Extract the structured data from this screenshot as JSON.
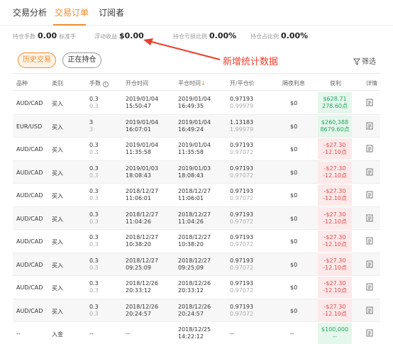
{
  "tabs": [
    {
      "label": "交易分析"
    },
    {
      "label": "交易订单"
    },
    {
      "label": "订阅者"
    }
  ],
  "stats": {
    "lots_label": "持仓手数",
    "lots_value": "0.00",
    "lots_sub": "标准手",
    "float_label": "浮动收益",
    "float_value": "$0.00",
    "loss_ratio_label": "持仓亏损比例",
    "loss_ratio_value": "0.00%",
    "ratio_label": "持仓占比例",
    "ratio_value": "0.00%"
  },
  "annotation": {
    "text": "新增统计数据",
    "color": "#e8402e"
  },
  "buttons": {
    "history": "历史交易",
    "open": "正在持仓",
    "filter": "筛选"
  },
  "columns": [
    "品种",
    "类别",
    "手数",
    "开仓时间",
    "平仓时间",
    "开/平仓价",
    "隔夜利息",
    "获利",
    "详情"
  ],
  "rows": [
    {
      "symbol": "AUD/CAD",
      "type": "买入",
      "lots": "0.3",
      "lots2": "0.3",
      "open_date": "2019/01/04",
      "open_time": "15:50:47",
      "close_date": "2019/01/04",
      "close_time": "16:49:35",
      "price1": "0.97193",
      "price2": "0.99979",
      "swap": "$0",
      "profit": "$628.71",
      "points": "278.60点",
      "positive": true
    },
    {
      "symbol": "EUR/USD",
      "type": "买入",
      "lots": "3",
      "lots2": "3",
      "open_date": "2019/01/04",
      "open_time": "16:07:01",
      "close_date": "2019/01/04",
      "close_time": "16:49:24",
      "price1": "1.13183",
      "price2": "1.99979",
      "swap": "$0",
      "profit": "$260,388",
      "points": "8679.60点",
      "positive": true
    },
    {
      "symbol": "AUD/CAD",
      "type": "买入",
      "lots": "0.3",
      "lots2": "0.3",
      "open_date": "2019/01/04",
      "open_time": "11:35:58",
      "close_date": "2019/01/04",
      "close_time": "11:35:58",
      "price1": "0.97193",
      "price2": "0.97072",
      "swap": "$0",
      "profit": "-$27.30",
      "points": "-12.10点",
      "positive": false
    },
    {
      "symbol": "AUD/CAD",
      "type": "买入",
      "lots": "0.3",
      "lots2": "0.3",
      "open_date": "2019/01/03",
      "open_time": "18:08:43",
      "close_date": "2019/01/03",
      "close_time": "18:08:43",
      "price1": "0.97193",
      "price2": "0.97072",
      "swap": "$0",
      "profit": "-$27.30",
      "points": "-12.10点",
      "positive": false
    },
    {
      "symbol": "AUD/CAD",
      "type": "买入",
      "lots": "0.3",
      "lots2": "0.3",
      "open_date": "2018/12/27",
      "open_time": "11:06:01",
      "close_date": "2018/12/27",
      "close_time": "11:06:01",
      "price1": "0.97193",
      "price2": "0.97072",
      "swap": "$0",
      "profit": "-$27.30",
      "points": "-12.10点",
      "positive": false
    },
    {
      "symbol": "AUD/CAD",
      "type": "买入",
      "lots": "0.3",
      "lots2": "0.3",
      "open_date": "2018/12/27",
      "open_time": "11:04:26",
      "close_date": "2018/12/27",
      "close_time": "11:04:26",
      "price1": "0.97193",
      "price2": "0.97072",
      "swap": "$0",
      "profit": "-$27.30",
      "points": "-12.10点",
      "positive": false
    },
    {
      "symbol": "AUD/CAD",
      "type": "买入",
      "lots": "0.3",
      "lots2": "0.3",
      "open_date": "2018/12/27",
      "open_time": "10:38:20",
      "close_date": "2018/12/27",
      "close_time": "10:38:20",
      "price1": "0.97193",
      "price2": "0.97072",
      "swap": "$0",
      "profit": "-$27.30",
      "points": "-12.10点",
      "positive": false
    },
    {
      "symbol": "AUD/CAD",
      "type": "买入",
      "lots": "0.3",
      "lots2": "0.3",
      "open_date": "2018/12/27",
      "open_time": "09:25:09",
      "close_date": "2018/12/27",
      "close_time": "09:25:09",
      "price1": "0.97193",
      "price2": "0.97072",
      "swap": "$0",
      "profit": "-$27.30",
      "points": "-12.10点",
      "positive": false
    },
    {
      "symbol": "AUD/CAD",
      "type": "买入",
      "lots": "0.3",
      "lots2": "0.3",
      "open_date": "2018/12/26",
      "open_time": "20:33:12",
      "close_date": "2018/12/26",
      "close_time": "20:33:12",
      "price1": "0.97193",
      "price2": "0.97072",
      "swap": "$0",
      "profit": "-$27.30",
      "points": "-12.10点",
      "positive": false
    },
    {
      "symbol": "AUD/CAD",
      "type": "买入",
      "lots": "0.3",
      "lots2": "0.3",
      "open_date": "2018/12/26",
      "open_time": "20:24:57",
      "close_date": "2018/12/26",
      "close_time": "20:24:57",
      "price1": "0.97193",
      "price2": "0.97072",
      "swap": "$0",
      "profit": "-$27.30",
      "points": "-12.10点",
      "positive": false
    },
    {
      "symbol": "--",
      "type": "入金",
      "lots": "--",
      "lots2": "",
      "open_date": "--",
      "open_time": "",
      "close_date": "2018/12/25",
      "close_time": "14:22:12",
      "price1": "--",
      "price2": "",
      "swap": "--",
      "profit": "$100,000",
      "points": "--",
      "positive": true
    }
  ],
  "colors": {
    "accent": "#f08c2e",
    "positive": "#1faa5c",
    "negative": "#e04a4a"
  }
}
